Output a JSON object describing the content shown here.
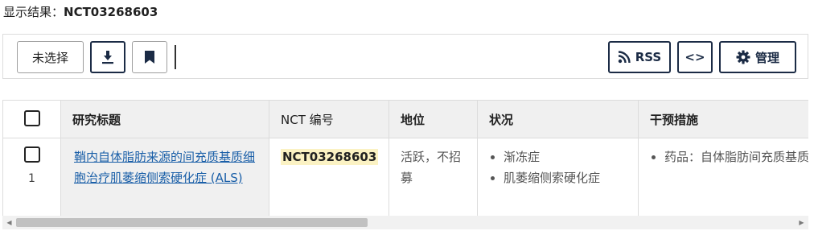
{
  "results": {
    "label": "显示结果：",
    "query": "NCT03268603"
  },
  "toolbar": {
    "unselect_label": "未选择",
    "download_icon": "download-icon",
    "bookmark_icon": "bookmark-icon",
    "rss_label": "RSS",
    "code_label": "<>",
    "manage_label": "管理"
  },
  "table": {
    "headers": [
      "研究标题",
      "NCT 编号",
      "地位",
      "状况",
      "干预措施"
    ],
    "rows": [
      {
        "index": "1",
        "title": "鞘内自体脂肪来源的间充质基质细胞治疗肌萎缩侧索硬化症 (ALS)",
        "nct": "NCT03268603",
        "status": "活跃，不招募",
        "conditions": [
          "渐冻症",
          "肌萎缩侧索硬化症"
        ],
        "interventions": [
          "药品：自体脂肪间充质基质"
        ]
      }
    ]
  },
  "colors": {
    "accent_dark": "#1b2b45",
    "link": "#1a5fa8",
    "highlight": "#fbf2c3",
    "header_bg": "#f0f0f0"
  }
}
